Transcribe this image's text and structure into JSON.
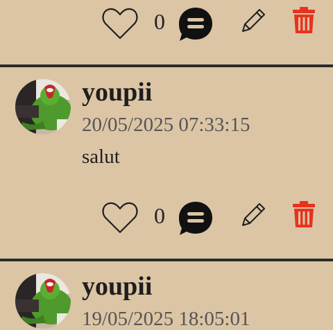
{
  "icons": {
    "like": "heart-outline-icon",
    "comment": "comment-bubble-icon",
    "edit": "pencil-icon",
    "delete": "trash-icon"
  },
  "colors": {
    "background": "#dcc5a5",
    "divider": "#2b2b2b",
    "delete": "#e8321e",
    "text": "#1e1e1e",
    "timestamp": "#555555"
  },
  "top_actions": {
    "like_count": "0"
  },
  "posts": [
    {
      "username": "youpii",
      "timestamp": "20/05/2025 07:33:15",
      "content": "salut",
      "like_count": "0"
    },
    {
      "username": "youpii",
      "timestamp": "19/05/2025 18:05:01"
    }
  ]
}
